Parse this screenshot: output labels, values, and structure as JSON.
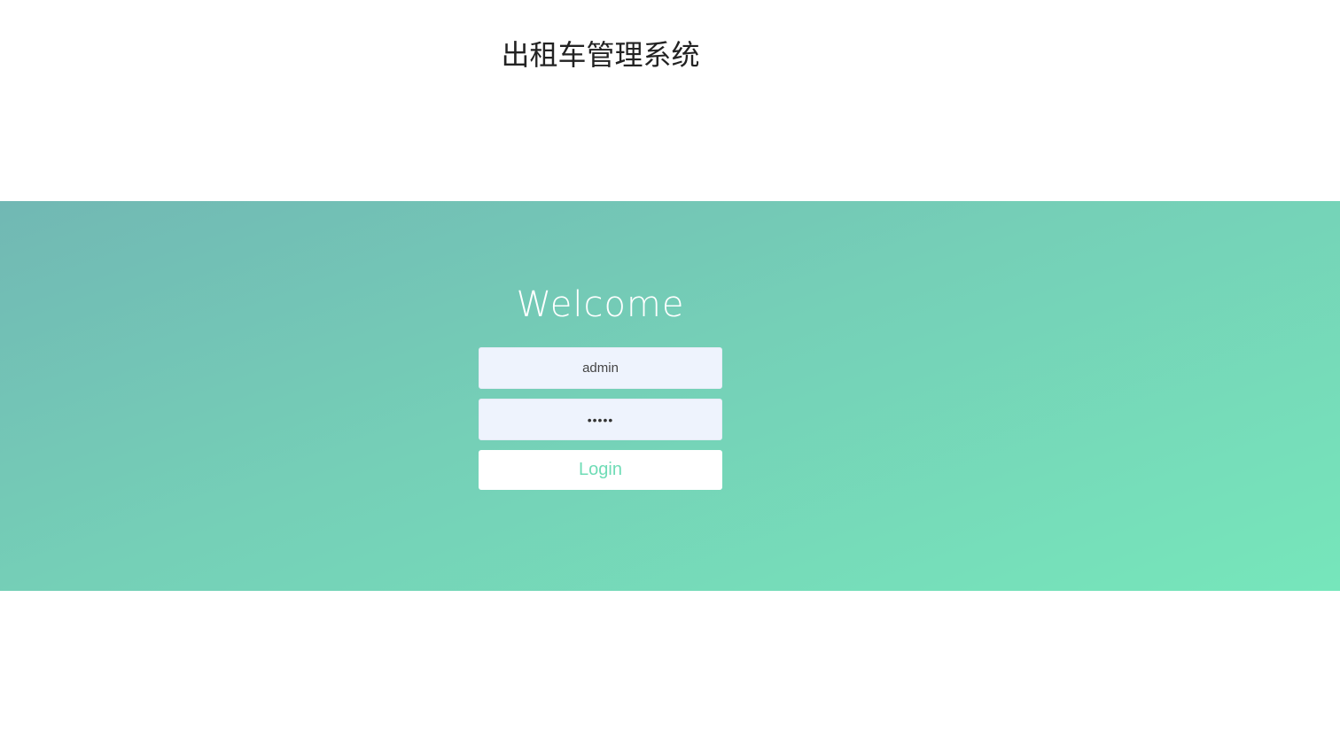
{
  "header": {
    "title": "出租车管理系统"
  },
  "login": {
    "welcome": "Welcome",
    "username_value": "admin",
    "password_value": "•••••",
    "button_label": "Login"
  },
  "colors": {
    "gradient_start": "#71b8b4",
    "gradient_end": "#76e6bb",
    "input_bg": "#eef3fd",
    "button_text": "#6fdcb6"
  }
}
